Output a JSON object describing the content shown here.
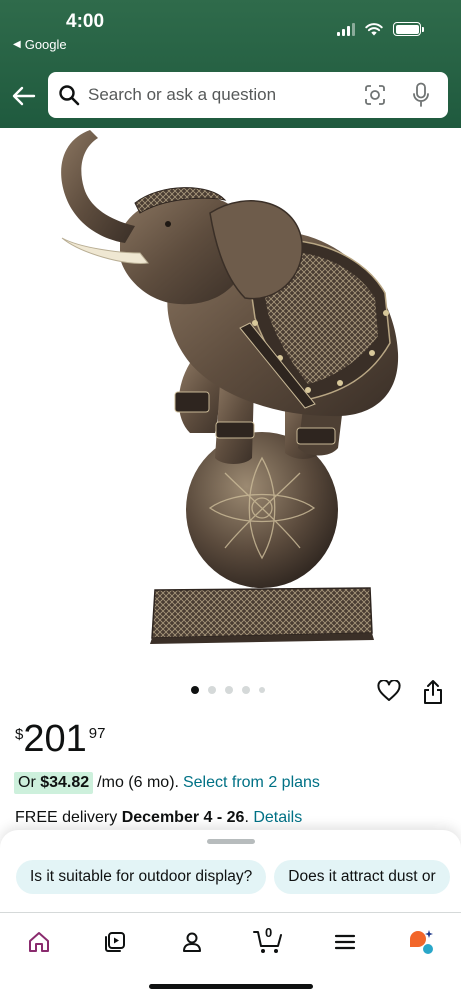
{
  "status_bar": {
    "time": "4:00",
    "back_app": "Google",
    "wifi": "wifi-icon",
    "battery": "battery-icon"
  },
  "search": {
    "placeholder": "Search or ask a question",
    "icons": [
      "back-arrow-icon",
      "search-icon",
      "camera-lens-icon",
      "microphone-icon"
    ]
  },
  "product": {
    "image_subject": "bronze elephant statue balancing on ball",
    "carousel": {
      "total_dots": 5,
      "active_index": 0
    },
    "price": {
      "currency": "$",
      "whole": "201",
      "fraction": "97"
    },
    "installment": {
      "prefix": "Or",
      "amount": "$34.82",
      "term": "/mo (6 mo).",
      "link": "Select from 2 plans"
    },
    "delivery": {
      "prefix": "FREE delivery",
      "dates": "December 4 - 26",
      "link": "Details"
    }
  },
  "suggestions": [
    "Is it suitable for outdoor display?",
    "Does it attract dust or"
  ],
  "bottom_nav": {
    "items": [
      "home-icon",
      "video-icon",
      "account-icon",
      "cart-icon",
      "menu-icon",
      "rufus-icon"
    ],
    "cart_count": "0",
    "active": "home-icon"
  },
  "colors": {
    "header": "#2f6b4b",
    "link": "#007185",
    "installment_highlight": "#cdf0dc",
    "chip": "#e3f4f6",
    "nav_active": "#8a2b6e"
  }
}
